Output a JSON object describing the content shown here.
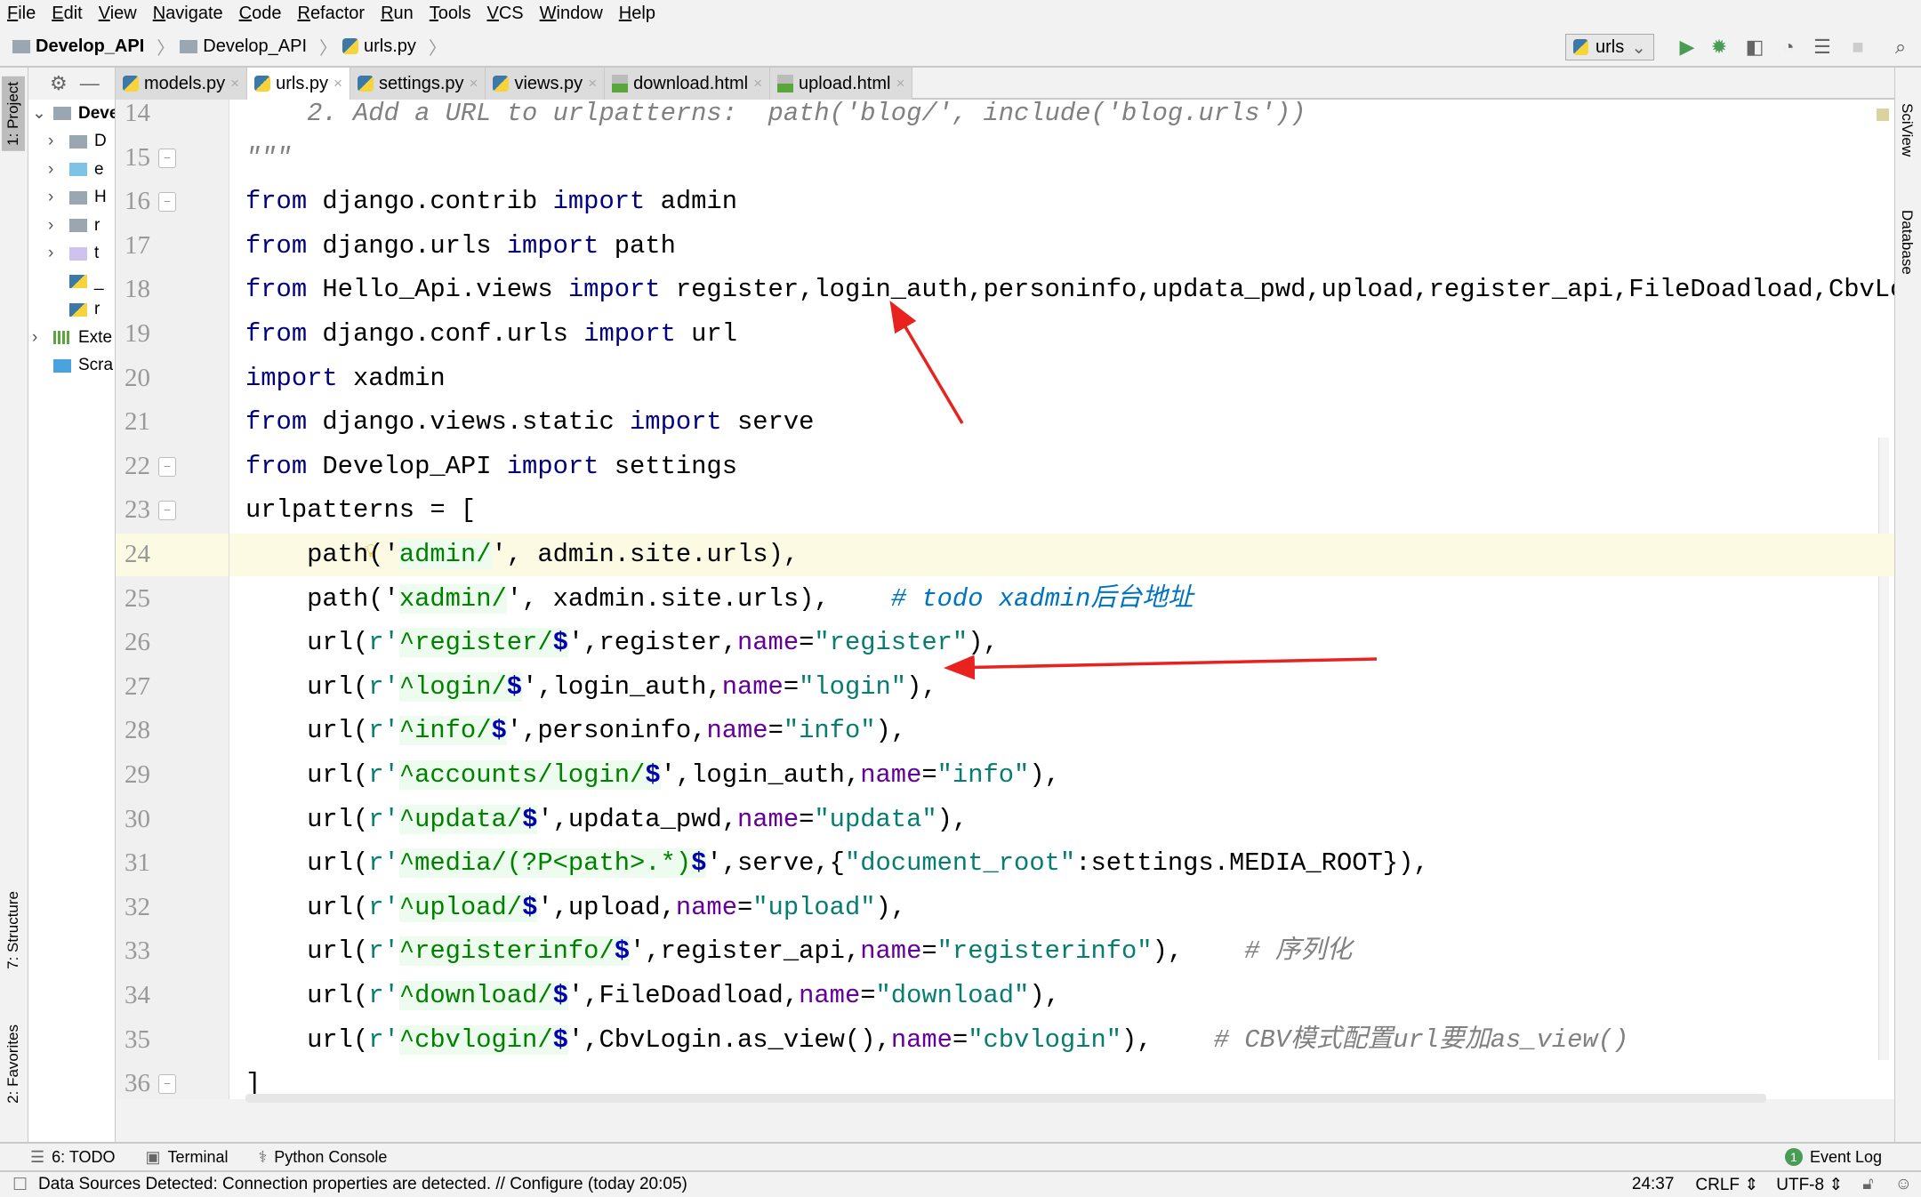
{
  "menu": [
    "File",
    "Edit",
    "View",
    "Navigate",
    "Code",
    "Refactor",
    "Run",
    "Tools",
    "VCS",
    "Window",
    "Help"
  ],
  "breadcrumb": [
    "Develop_API",
    "Develop_API",
    "urls.py"
  ],
  "run_config": "urls",
  "toolbar_icons": [
    "run-icon",
    "debug-icon",
    "coverage-icon",
    "profile-icon",
    "concurrency-icon",
    "stop-icon",
    "search-icon"
  ],
  "left_tabs": {
    "project": "1: Project",
    "structure": "7: Structure",
    "favorites": "2: Favorites"
  },
  "right_tabs": {
    "sciview": "SciView",
    "database": "Database"
  },
  "project_tree": {
    "root": "Deve",
    "items": [
      {
        "label": "D",
        "type": "folder"
      },
      {
        "label": "e",
        "type": "folder-blue"
      },
      {
        "label": "H",
        "type": "folder"
      },
      {
        "label": "r",
        "type": "folder"
      },
      {
        "label": "t",
        "type": "folder-purple"
      },
      {
        "label": "_",
        "type": "python-file"
      },
      {
        "label": "r",
        "type": "python-file"
      }
    ],
    "external": "Exte",
    "scratches": "Scra"
  },
  "tabs": [
    {
      "label": "models.py",
      "type": "py",
      "active": false
    },
    {
      "label": "urls.py",
      "type": "py",
      "active": true
    },
    {
      "label": "settings.py",
      "type": "py",
      "active": false
    },
    {
      "label": "views.py",
      "type": "py",
      "active": false
    },
    {
      "label": "download.html",
      "type": "html",
      "active": false
    },
    {
      "label": "upload.html",
      "type": "html",
      "active": false
    }
  ],
  "editor": {
    "current_line": 24,
    "lines": [
      {
        "n": "14",
        "t": [
          [
            "    2. Add a URL to urlpatterns:  path('blog/', include('blog.urls'))",
            "cm"
          ]
        ]
      },
      {
        "n": "15",
        "t": [
          [
            "\"\"\"",
            "cm"
          ]
        ]
      },
      {
        "n": "16",
        "t": [
          [
            "from",
            "kw"
          ],
          [
            " django.contrib ",
            ""
          ],
          [
            "import",
            "kw"
          ],
          [
            " admin",
            ""
          ]
        ]
      },
      {
        "n": "17",
        "t": [
          [
            "from",
            "kw"
          ],
          [
            " django.urls ",
            ""
          ],
          [
            "import",
            "kw"
          ],
          [
            " path",
            ""
          ]
        ]
      },
      {
        "n": "18",
        "t": [
          [
            "from",
            "kw"
          ],
          [
            " Hello_Api.views ",
            ""
          ],
          [
            "import",
            "kw"
          ],
          [
            " register,login_auth,personinfo,updata_pwd,upload,register_api,FileDoadload,CbvLogin",
            ""
          ]
        ]
      },
      {
        "n": "19",
        "t": [
          [
            "from",
            "kw"
          ],
          [
            " django.conf.urls ",
            ""
          ],
          [
            "import",
            "kw"
          ],
          [
            " url",
            ""
          ]
        ]
      },
      {
        "n": "20",
        "t": [
          [
            "import",
            "kw"
          ],
          [
            " xadmin",
            ""
          ]
        ]
      },
      {
        "n": "21",
        "t": [
          [
            "from",
            "kw"
          ],
          [
            " django.views.static ",
            ""
          ],
          [
            "import",
            "kw"
          ],
          [
            " serve",
            ""
          ]
        ]
      },
      {
        "n": "22",
        "t": [
          [
            "from",
            "kw"
          ],
          [
            " Develop_API ",
            ""
          ],
          [
            "import",
            "kw"
          ],
          [
            " settings",
            ""
          ]
        ]
      },
      {
        "n": "23",
        "t": [
          [
            "urlpatterns = [",
            ""
          ]
        ]
      },
      {
        "n": "24",
        "t": [
          [
            "    path('",
            ""
          ],
          [
            "admin/",
            "rx"
          ],
          [
            "', admin.site.urls),",
            ""
          ]
        ]
      },
      {
        "n": "25",
        "t": [
          [
            "    path('",
            ""
          ],
          [
            "xadmin/",
            "rx"
          ],
          [
            "', xadmin.site.urls),    ",
            ""
          ],
          [
            "# todo xadmin后台地址",
            "td"
          ]
        ]
      },
      {
        "n": "26",
        "t": [
          [
            "    url(",
            ""
          ],
          [
            "r'",
            "pn"
          ],
          [
            "^register/",
            "rx"
          ],
          [
            "$",
            "dl"
          ],
          [
            "',register,",
            ""
          ],
          [
            "name",
            "nm"
          ],
          [
            "=",
            ""
          ],
          [
            "\"register\"",
            "st"
          ],
          [
            "),",
            ""
          ]
        ]
      },
      {
        "n": "27",
        "t": [
          [
            "    url(",
            ""
          ],
          [
            "r'",
            "pn"
          ],
          [
            "^login/",
            "rx"
          ],
          [
            "$",
            "dl"
          ],
          [
            "',login_auth,",
            ""
          ],
          [
            "name",
            "nm"
          ],
          [
            "=",
            ""
          ],
          [
            "\"login\"",
            "st"
          ],
          [
            "),",
            ""
          ]
        ]
      },
      {
        "n": "28",
        "t": [
          [
            "    url(",
            ""
          ],
          [
            "r'",
            "pn"
          ],
          [
            "^info/",
            "rx"
          ],
          [
            "$",
            "dl"
          ],
          [
            "',personinfo,",
            ""
          ],
          [
            "name",
            "nm"
          ],
          [
            "=",
            ""
          ],
          [
            "\"info\"",
            "st"
          ],
          [
            "),",
            ""
          ]
        ]
      },
      {
        "n": "29",
        "t": [
          [
            "    url(",
            ""
          ],
          [
            "r'",
            "pn"
          ],
          [
            "^accounts/login/",
            "rx"
          ],
          [
            "$",
            "dl"
          ],
          [
            "',login_auth,",
            ""
          ],
          [
            "name",
            "nm"
          ],
          [
            "=",
            ""
          ],
          [
            "\"info\"",
            "st"
          ],
          [
            "),",
            ""
          ]
        ]
      },
      {
        "n": "30",
        "t": [
          [
            "    url(",
            ""
          ],
          [
            "r'",
            "pn"
          ],
          [
            "^updata/",
            "rx"
          ],
          [
            "$",
            "dl"
          ],
          [
            "',updata_pwd,",
            ""
          ],
          [
            "name",
            "nm"
          ],
          [
            "=",
            ""
          ],
          [
            "\"updata\"",
            "st"
          ],
          [
            "),",
            ""
          ]
        ]
      },
      {
        "n": "31",
        "t": [
          [
            "    url(",
            ""
          ],
          [
            "r'",
            "pn"
          ],
          [
            "^media/(?P<path>.*)",
            "rx"
          ],
          [
            "$",
            "dl"
          ],
          [
            "',serve,{",
            ""
          ],
          [
            "\"document_root\"",
            "st"
          ],
          [
            ":settings.MEDIA_ROOT}),",
            ""
          ]
        ]
      },
      {
        "n": "32",
        "t": [
          [
            "    url(",
            ""
          ],
          [
            "r'",
            "pn"
          ],
          [
            "^upload/",
            "rx"
          ],
          [
            "$",
            "dl"
          ],
          [
            "',upload,",
            ""
          ],
          [
            "name",
            "nm"
          ],
          [
            "=",
            ""
          ],
          [
            "\"upload\"",
            "st"
          ],
          [
            "),",
            ""
          ]
        ]
      },
      {
        "n": "33",
        "t": [
          [
            "    url(",
            ""
          ],
          [
            "r'",
            "pn"
          ],
          [
            "^registerinfo/",
            "rx"
          ],
          [
            "$",
            "dl"
          ],
          [
            "',register_api,",
            ""
          ],
          [
            "name",
            "nm"
          ],
          [
            "=",
            ""
          ],
          [
            "\"registerinfo\"",
            "st"
          ],
          [
            "),    ",
            ""
          ],
          [
            "# 序列化",
            "cm"
          ]
        ]
      },
      {
        "n": "34",
        "t": [
          [
            "    url(",
            ""
          ],
          [
            "r'",
            "pn"
          ],
          [
            "^download/",
            "rx"
          ],
          [
            "$",
            "dl"
          ],
          [
            "',FileDoadload,",
            ""
          ],
          [
            "name",
            "nm"
          ],
          [
            "=",
            ""
          ],
          [
            "\"download\"",
            "st"
          ],
          [
            "),",
            ""
          ]
        ]
      },
      {
        "n": "35",
        "t": [
          [
            "    url(",
            ""
          ],
          [
            "r'",
            "pn"
          ],
          [
            "^cbvlogin/",
            "rx"
          ],
          [
            "$",
            "dl"
          ],
          [
            "',CbvLogin.as_view(),",
            ""
          ],
          [
            "name",
            "nm"
          ],
          [
            "=",
            ""
          ],
          [
            "\"cbvlogin\"",
            "st"
          ],
          [
            "),    ",
            ""
          ],
          [
            "# CBV模式配置url要加as_view()",
            "cm"
          ]
        ]
      },
      {
        "n": "36",
        "t": [
          [
            "]",
            ""
          ]
        ]
      }
    ]
  },
  "tool_windows": [
    {
      "label": "6: TODO",
      "icon": "todo-list-icon"
    },
    {
      "label": "Terminal",
      "icon": "terminal-icon"
    },
    {
      "label": "Python Console",
      "icon": "python-console-icon"
    }
  ],
  "event_log": {
    "label": "Event Log",
    "count": "1"
  },
  "status": {
    "message": "Data Sources Detected: Connection properties are detected. // Configure (today 20:05)",
    "position": "24:37",
    "line_sep": "CRLF ⇕",
    "encoding": "UTF-8 ⇕"
  },
  "colors": {
    "annotation_arrow": "#e8231f",
    "current_line": "#fcfae3",
    "keyword": "#000080",
    "regex": "#008000"
  }
}
